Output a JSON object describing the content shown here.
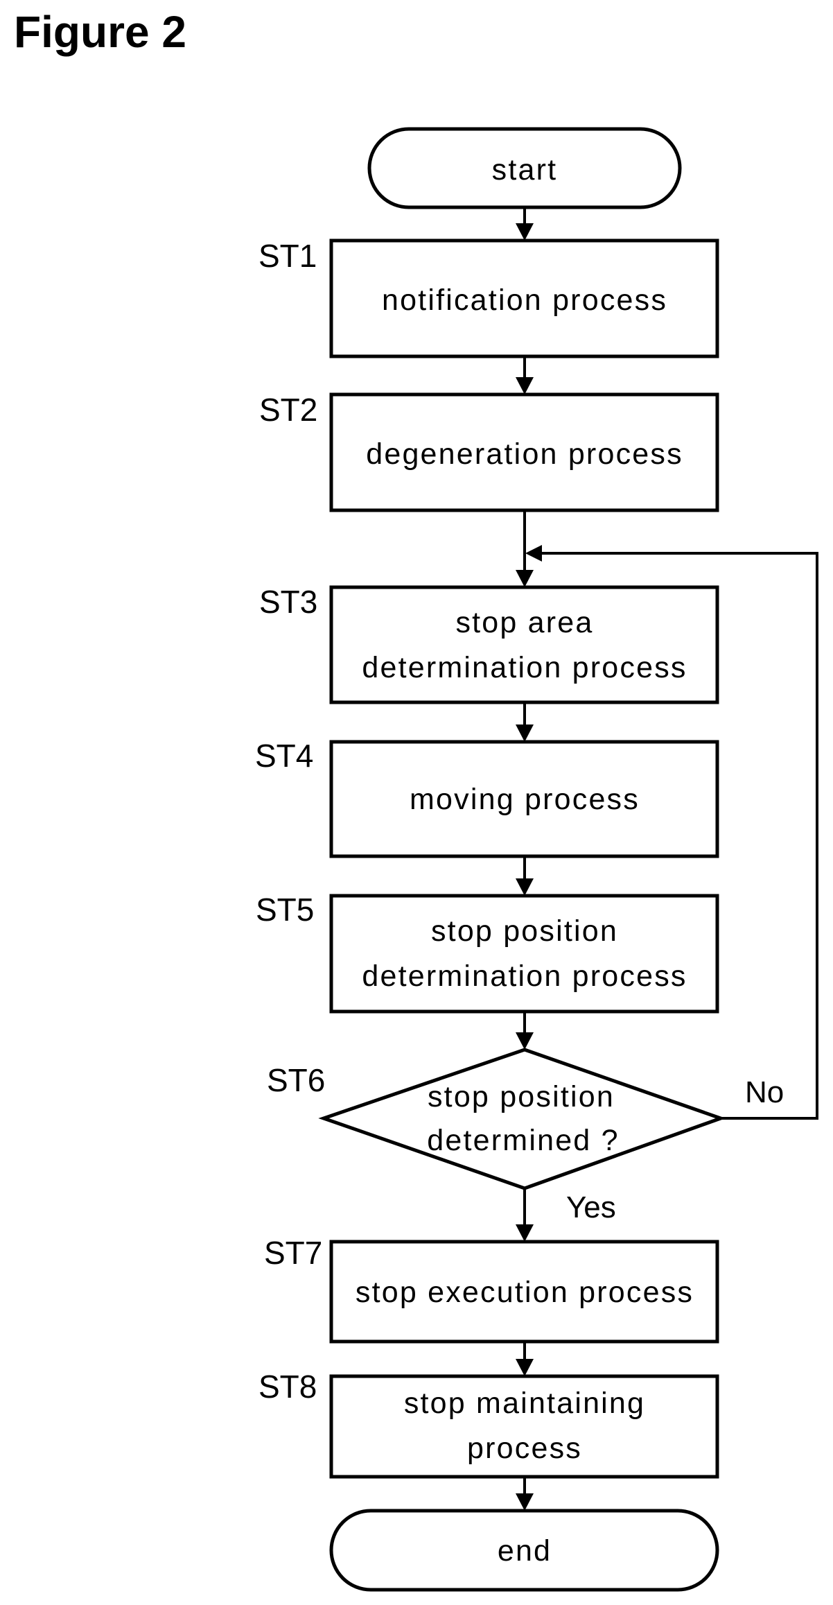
{
  "figure": {
    "title": "Figure 2"
  },
  "flowchart": {
    "start": {
      "text": "start"
    },
    "end": {
      "text": "end"
    },
    "steps": [
      {
        "id": "ST1",
        "type": "process",
        "lines": [
          "notification process"
        ]
      },
      {
        "id": "ST2",
        "type": "process",
        "lines": [
          "degeneration process"
        ]
      },
      {
        "id": "ST3",
        "type": "process",
        "lines": [
          "stop area",
          "determination process"
        ]
      },
      {
        "id": "ST4",
        "type": "process",
        "lines": [
          "moving process"
        ]
      },
      {
        "id": "ST5",
        "type": "process",
        "lines": [
          "stop position",
          "determination process"
        ]
      },
      {
        "id": "ST6",
        "type": "decision",
        "lines": [
          "stop position",
          "determined ?"
        ]
      },
      {
        "id": "ST7",
        "type": "process",
        "lines": [
          "stop execution process"
        ]
      },
      {
        "id": "ST8",
        "type": "process",
        "lines": [
          "stop maintaining",
          "process"
        ]
      }
    ],
    "branches": {
      "no": {
        "label": "No",
        "target": "ST3"
      },
      "yes": {
        "label": "Yes",
        "target": "ST7"
      }
    },
    "colors": {
      "stroke": "#000000",
      "background": "#ffffff"
    }
  }
}
